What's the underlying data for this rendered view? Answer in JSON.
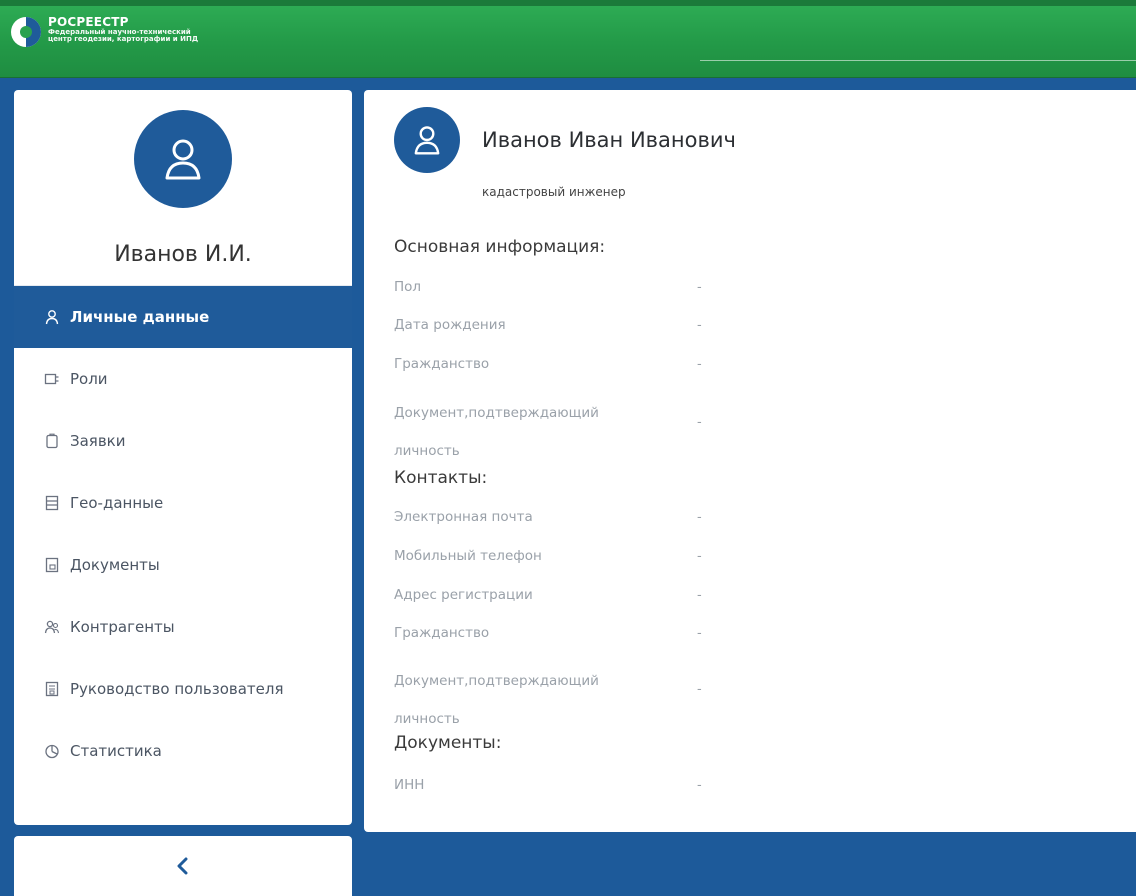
{
  "header": {
    "logo_title": "РОСРЕЕСТР",
    "logo_sub_1": "Федеральный научно-технический",
    "logo_sub_2": "центр геодезии, картографии и ИПД"
  },
  "sidebar": {
    "short_name": "Иванов И.И.",
    "items": [
      {
        "label": "Личные данные",
        "icon": "user-icon",
        "active": true
      },
      {
        "label": "Роли",
        "icon": "roles-icon",
        "active": false
      },
      {
        "label": "Заявки",
        "icon": "clipboard-icon",
        "active": false
      },
      {
        "label": "Гео-данные",
        "icon": "list-icon",
        "active": false
      },
      {
        "label": "Документы",
        "icon": "document-icon",
        "active": false
      },
      {
        "label": "Контрагенты",
        "icon": "contractors-icon",
        "active": false
      },
      {
        "label": "Руководство пользователя",
        "icon": "manual-icon",
        "active": false
      },
      {
        "label": "Статистика",
        "icon": "chart-pie-icon",
        "active": false
      }
    ],
    "collapse_icon": "chevron-left-icon"
  },
  "main": {
    "full_name": "Иванов Иван Иванович",
    "role": "кадастровый инженер",
    "sections": {
      "basic": {
        "title": "Основная информация:",
        "fields": [
          {
            "label": "Пол",
            "value": "-"
          },
          {
            "label": "Дата рождения",
            "value": "-"
          },
          {
            "label": "Гражданство",
            "value": "-"
          },
          {
            "label": "Документ,подтверждающий личность",
            "value": "-"
          }
        ]
      },
      "contacts": {
        "title": "Контакты:",
        "fields": [
          {
            "label": "Электронная почта",
            "value": "-"
          },
          {
            "label": "Мобильный телефон",
            "value": "-"
          },
          {
            "label": "Адрес регистрации",
            "value": "-"
          },
          {
            "label": "Гражданство",
            "value": "-"
          },
          {
            "label": "Документ,подтверждающий личность",
            "value": "-"
          }
        ]
      },
      "documents": {
        "title": "Документы:",
        "fields": [
          {
            "label": "ИНН",
            "value": "-"
          }
        ]
      }
    }
  },
  "colors": {
    "brand_blue": "#1f5b9a",
    "header_green": "#2aa14f",
    "label_gray": "#9aa1a9"
  }
}
